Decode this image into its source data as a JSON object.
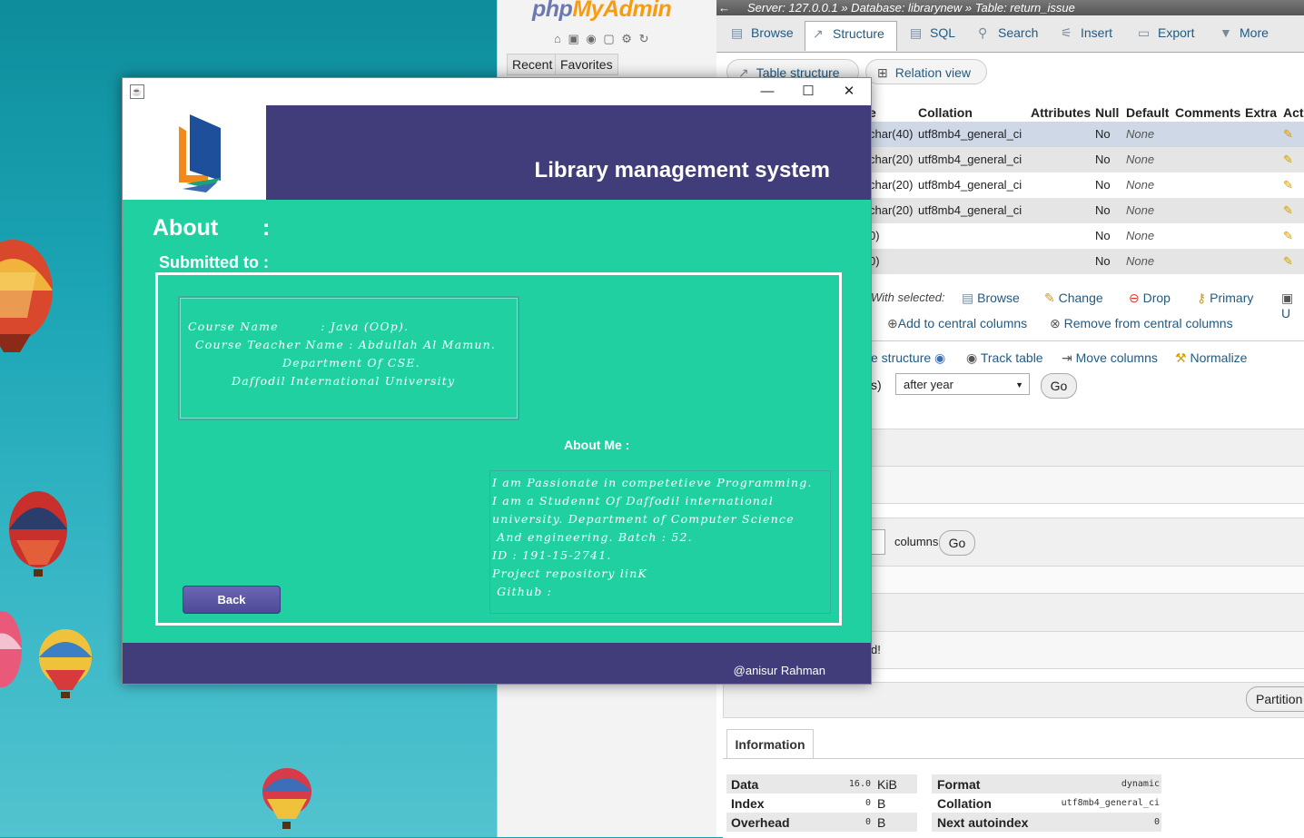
{
  "java_app": {
    "title": "Library management system",
    "about_heading": "About",
    "about_colon": ":",
    "submitted_to": "Submitted to :",
    "course_lines": [
      "Course Name         : Java (OOp).",
      "Course Teacher Name : Abdullah Al Mamun.",
      "Department Of CSE.",
      "Daffodil International University"
    ],
    "about_me_title": "About Me :",
    "about_me_lines": [
      "I am Passionate in competetieve Programming.",
      "I am a Studennt Of Daffodil international",
      "university. Department of Computer Science",
      " And engineering. Batch : 52.",
      "ID : 191-15-2741.",
      "Project repository linK",
      " Github :"
    ],
    "back_button": "Back",
    "author": "@anisur Rahman",
    "window_controls": {
      "minimize": "—",
      "maximize": "☐",
      "close": "✕"
    },
    "colors": {
      "header": "#403d7a",
      "body": "#20d0a0",
      "button": "#5b58a8"
    }
  },
  "pma": {
    "logo": {
      "php": "php",
      "my": "MyAdmin"
    },
    "nav_tabs": [
      "Recent",
      "Favorites"
    ],
    "breadcrumb": "Server: 127.0.0.1 » Database: librarynew » Table: return_issue",
    "tabs": [
      "Browse",
      "Structure",
      "SQL",
      "Search",
      "Insert",
      "Export",
      "More"
    ],
    "sub_tabs": [
      "Table structure",
      "Relation view"
    ],
    "columns": [
      "e",
      "Collation",
      "Attributes",
      "Null",
      "Default",
      "Comments",
      "Extra",
      "Acti"
    ],
    "rows": [
      {
        "type": "char(40)",
        "collation": "utf8mb4_general_ci",
        "null": "No",
        "default": "None"
      },
      {
        "type": "char(20)",
        "collation": "utf8mb4_general_ci",
        "null": "No",
        "default": "None"
      },
      {
        "type": "char(20)",
        "collation": "utf8mb4_general_ci",
        "null": "No",
        "default": "None"
      },
      {
        "type": "char(20)",
        "collation": "utf8mb4_general_ci",
        "null": "No",
        "default": "None"
      },
      {
        "type": "0)",
        "collation": "",
        "null": "No",
        "default": "None"
      },
      {
        "type": "0)",
        "collation": "",
        "null": "No",
        "default": "None"
      }
    ],
    "with_selected": "With selected:",
    "bulk_actions": [
      "Browse",
      "Change",
      "Drop",
      "Primary",
      "U"
    ],
    "central_actions": [
      "Add to central columns",
      "Remove from central columns"
    ],
    "struct_actions": [
      "e structure",
      "Track table",
      "Move columns",
      "Normalize"
    ],
    "after_label": "s)",
    "after_select": "after year",
    "go": "Go",
    "columns_label": "columns",
    "d_text": "d!",
    "partition": "Partition t",
    "information": "Information",
    "info_left": [
      {
        "label": "Data",
        "value": "16.0",
        "unit": "KiB"
      },
      {
        "label": "Index",
        "value": "0",
        "unit": "B"
      },
      {
        "label": "Overhead",
        "value": "0",
        "unit": "B"
      }
    ],
    "info_right": [
      {
        "label": "Format",
        "value": "dynamic"
      },
      {
        "label": "Collation",
        "value": "utf8mb4_general_ci"
      },
      {
        "label": "Next autoindex",
        "value": "0"
      }
    ]
  }
}
